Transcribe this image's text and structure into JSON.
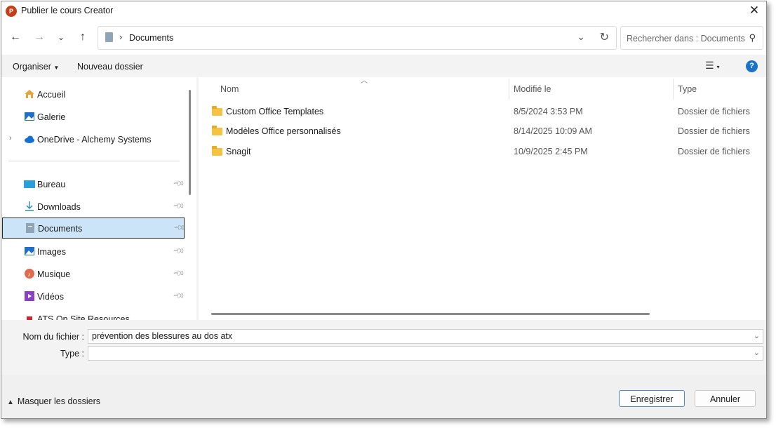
{
  "window": {
    "title": "Publier le cours Creator",
    "app_icon_letter": "P"
  },
  "nav": {
    "address_path": "Documents",
    "search_placeholder": "Rechercher dans : Documents"
  },
  "toolbar": {
    "organize_label": "Organiser",
    "new_folder_label": "Nouveau dossier"
  },
  "sidebar": {
    "top_items": [
      {
        "label": "Accueil",
        "icon": "home-icon"
      },
      {
        "label": "Galerie",
        "icon": "gallery-icon"
      },
      {
        "label": "OneDrive - Alchemy Systems",
        "icon": "cloud-icon"
      }
    ],
    "pinned_items": [
      {
        "label": "Bureau",
        "icon": "desktop-icon"
      },
      {
        "label": "Downloads",
        "icon": "download-icon"
      },
      {
        "label": "Documents",
        "icon": "document-icon",
        "selected": true
      },
      {
        "label": "Images",
        "icon": "images-icon"
      },
      {
        "label": "Musique",
        "icon": "music-icon"
      },
      {
        "label": "Vidéos",
        "icon": "video-icon"
      },
      {
        "label": "ATS On Site Resources",
        "icon": "shortcut-icon"
      }
    ]
  },
  "file_list": {
    "columns": [
      "Nom",
      "Modifié le",
      "Type"
    ],
    "rows": [
      {
        "name": "Custom Office Templates",
        "modified": "8/5/2024 3:53 PM",
        "type": "Dossier de fichiers"
      },
      {
        "name": "Modèles Office personnalisés",
        "modified": "8/14/2025 10:09 AM",
        "type": "Dossier de fichiers"
      },
      {
        "name": "Snagit",
        "modified": "10/9/2025 2:45 PM",
        "type": "Dossier de fichiers"
      }
    ]
  },
  "form": {
    "filename_label": "Nom du fichier :",
    "filename_value": "prévention des blessures au dos atx",
    "type_label": "Type :",
    "type_value": ""
  },
  "footer": {
    "hide_folders_label": "Masquer les dossiers",
    "save_label": "Enregistrer",
    "cancel_label": "Annuler"
  },
  "colors": {
    "accent": "#1a73c8",
    "selection": "#cce4f7",
    "folder": "#f5c242",
    "app_icon": "#c43e1c"
  }
}
